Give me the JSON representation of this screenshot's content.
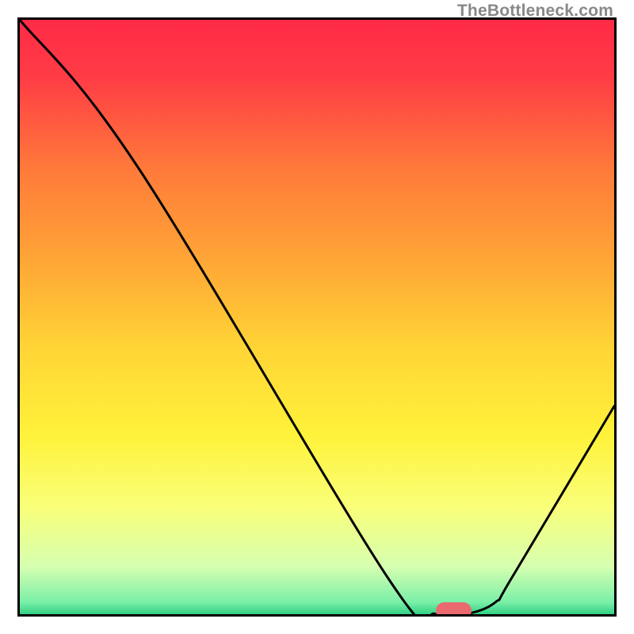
{
  "watermark": "TheBottleneck.com",
  "chart_data": {
    "type": "line",
    "title": "",
    "xlabel": "",
    "ylabel": "",
    "xlim": [
      0,
      100
    ],
    "ylim": [
      0,
      100
    ],
    "background": {
      "gradient_stops": [
        {
          "offset": 0.0,
          "color": "#ff2a47"
        },
        {
          "offset": 0.1,
          "color": "#ff3d45"
        },
        {
          "offset": 0.25,
          "color": "#ff7a3a"
        },
        {
          "offset": 0.4,
          "color": "#ffa436"
        },
        {
          "offset": 0.55,
          "color": "#ffd436"
        },
        {
          "offset": 0.7,
          "color": "#fff23a"
        },
        {
          "offset": 0.82,
          "color": "#f9ff7a"
        },
        {
          "offset": 0.92,
          "color": "#d6ffb0"
        },
        {
          "offset": 0.98,
          "color": "#7aefa8"
        },
        {
          "offset": 1.0,
          "color": "#33d184"
        }
      ]
    },
    "series": [
      {
        "name": "bottleneck-curve",
        "x": [
          0,
          20,
          62,
          70,
          75,
          80,
          83,
          100
        ],
        "values": [
          100,
          75,
          6,
          0,
          0,
          2,
          6.5,
          35
        ]
      }
    ],
    "markers": [
      {
        "name": "optimal-region",
        "shape": "capsule",
        "color": "#e86a6f",
        "x_start": 70,
        "x_end": 76,
        "y": 0.6,
        "thickness": 2.8
      }
    ]
  }
}
